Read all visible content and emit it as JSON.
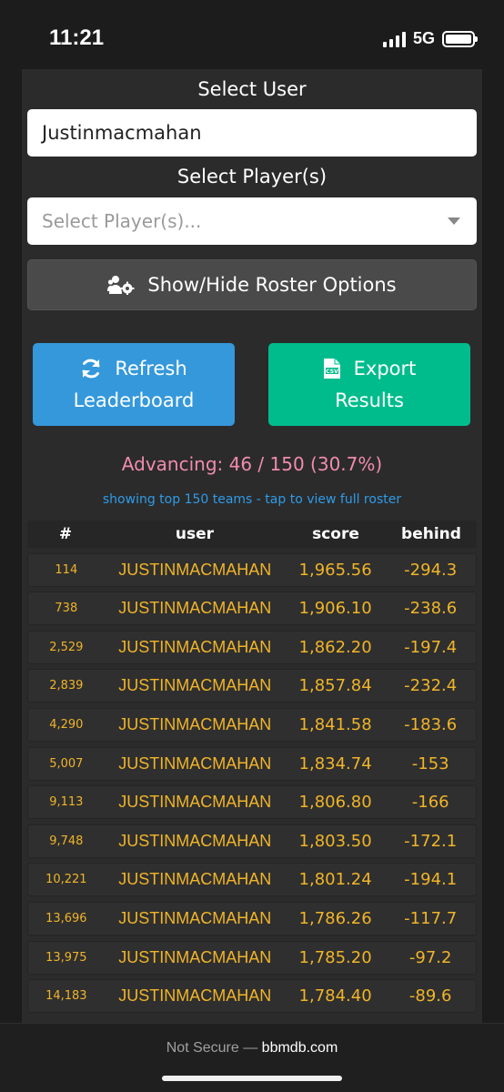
{
  "status": {
    "time": "11:21",
    "network": "5G"
  },
  "form": {
    "select_user_label": "Select User",
    "user_value": "Justinmacmahan",
    "select_players_label": "Select Player(s)",
    "players_placeholder": "Select Player(s)..."
  },
  "buttons": {
    "roster_toggle": "Show/Hide Roster Options",
    "refresh_line1": "Refresh",
    "refresh_line2": "Leaderboard",
    "export_line1": "Export",
    "export_line2": "Results"
  },
  "summary": {
    "advancing": "Advancing: 46 / 150 (30.7%)",
    "showing": "showing top 150 teams - tap to view full roster"
  },
  "table": {
    "headers": [
      "#",
      "user",
      "score",
      "behind"
    ],
    "rows": [
      {
        "rank": "114",
        "user": "JUSTINMACMAHAN",
        "score": "1,965.56",
        "behind": "-294.3"
      },
      {
        "rank": "738",
        "user": "JUSTINMACMAHAN",
        "score": "1,906.10",
        "behind": "-238.6"
      },
      {
        "rank": "2,529",
        "user": "JUSTINMACMAHAN",
        "score": "1,862.20",
        "behind": "-197.4"
      },
      {
        "rank": "2,839",
        "user": "JUSTINMACMAHAN",
        "score": "1,857.84",
        "behind": "-232.4"
      },
      {
        "rank": "4,290",
        "user": "JUSTINMACMAHAN",
        "score": "1,841.58",
        "behind": "-183.6"
      },
      {
        "rank": "5,007",
        "user": "JUSTINMACMAHAN",
        "score": "1,834.74",
        "behind": "-153"
      },
      {
        "rank": "9,113",
        "user": "JUSTINMACMAHAN",
        "score": "1,806.80",
        "behind": "-166"
      },
      {
        "rank": "9,748",
        "user": "JUSTINMACMAHAN",
        "score": "1,803.50",
        "behind": "-172.1"
      },
      {
        "rank": "10,221",
        "user": "JUSTINMACMAHAN",
        "score": "1,801.24",
        "behind": "-194.1"
      },
      {
        "rank": "13,696",
        "user": "JUSTINMACMAHAN",
        "score": "1,786.26",
        "behind": "-117.7"
      },
      {
        "rank": "13,975",
        "user": "JUSTINMACMAHAN",
        "score": "1,785.20",
        "behind": "-97.2"
      },
      {
        "rank": "14,183",
        "user": "JUSTINMACMAHAN",
        "score": "1,784.40",
        "behind": "-89.6"
      }
    ]
  },
  "browser": {
    "not_secure": "Not Secure —",
    "domain": "bbmdb.com"
  },
  "colors": {
    "refresh_button": "#3498db",
    "export_button": "#00bc8c",
    "advancing_text": "#f08cae",
    "link_text": "#2f9be8",
    "row_text": "#f0b429"
  },
  "icons": {
    "roster": "users-cog-icon",
    "refresh": "sync-icon",
    "export": "csv-file-icon"
  }
}
